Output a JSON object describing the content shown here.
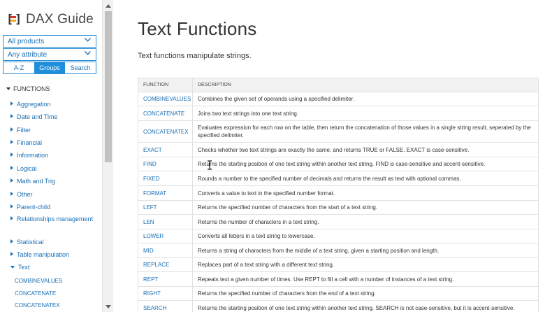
{
  "logo": {
    "text": "DAX Guide",
    "eq_colors": [
      "#e0322b",
      "#f2a81d",
      "#38a642"
    ]
  },
  "filters": {
    "products": "All products",
    "attributes": "Any attribute"
  },
  "view_tabs": [
    {
      "label": "A-Z",
      "active": false
    },
    {
      "label": "Groups",
      "active": true
    },
    {
      "label": "Search",
      "active": false
    }
  ],
  "sidebar": {
    "functions_label": "FUNCTIONS",
    "groups": [
      "Aggregation",
      "Date and Time",
      "Filter",
      "Financial",
      "Information",
      "Logical",
      "Math and Trig",
      "Other",
      "Parent-child",
      "Relationships management",
      "Statistical",
      "Table manipulation",
      "Text"
    ],
    "text_subitems": [
      "COMBINEVALUES",
      "CONCATENATE",
      "CONCATENATEX"
    ]
  },
  "page": {
    "title": "Text Functions",
    "intro": "Text functions manipulate strings."
  },
  "table": {
    "headers": [
      "FUNCTION",
      "DESCRIPTION"
    ],
    "rows": [
      {
        "fn": "COMBINEVALUES",
        "desc": "Combines the given set of operands using a specified delimiter."
      },
      {
        "fn": "CONCATENATE",
        "desc": "Joins two text strings into one text string."
      },
      {
        "fn": "CONCATENATEX",
        "desc": "Evaluates expression for each row on the table, then return the concatenation of those values in a single string result, seperated by the specified delimiter."
      },
      {
        "fn": "EXACT",
        "desc": "Checks whether two text strings are exactly the same, and returns TRUE or FALSE. EXACT is case-sensitive."
      },
      {
        "fn": "FIND",
        "desc": "Returns the starting position of one text string within another text string. FIND is case-sensitive and accent-sensitive."
      },
      {
        "fn": "FIXED",
        "desc": "Rounds a number to the specified number of decimals and returns the result as text with optional commas."
      },
      {
        "fn": "FORMAT",
        "desc": "Converts a value to text in the specified number format."
      },
      {
        "fn": "LEFT",
        "desc": "Returns the specified number of characters from the start of a text string."
      },
      {
        "fn": "LEN",
        "desc": "Returns the number of characters in a text string."
      },
      {
        "fn": "LOWER",
        "desc": "Converts all letters in a text string to lowercase."
      },
      {
        "fn": "MID",
        "desc": "Returns a string of characters from the middle of a text string, given a starting position and length."
      },
      {
        "fn": "REPLACE",
        "desc": "Replaces part of a text string with a different text string."
      },
      {
        "fn": "REPT",
        "desc": "Repeats text a given number of times. Use REPT to fill a cell with a number of instances of a text string."
      },
      {
        "fn": "RIGHT",
        "desc": "Returns the specified number of characters from the end of a text string."
      },
      {
        "fn": "SEARCH",
        "desc": "Returns the starting position of one text string within another text string. SEARCH is not case-sensitive, but it is accent-sensitive."
      }
    ]
  }
}
